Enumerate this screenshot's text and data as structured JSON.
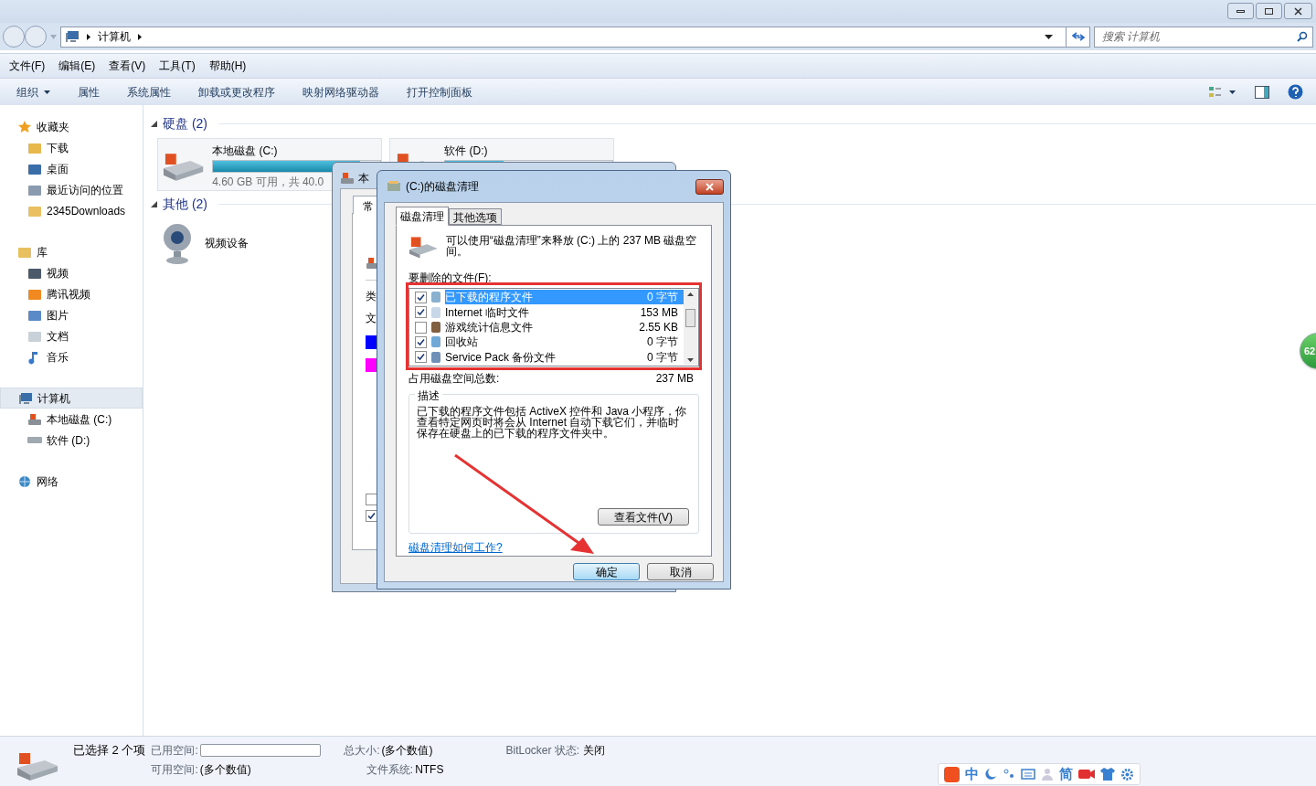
{
  "window": {
    "path": [
      "计算机"
    ],
    "search": {
      "placeholder": "搜索 计算机"
    }
  },
  "menu": [
    "文件(F)",
    "编辑(E)",
    "查看(V)",
    "工具(T)",
    "帮助(H)"
  ],
  "toolbar": [
    {
      "label": "组织",
      "dropdown": true
    },
    {
      "label": "属性",
      "dropdown": false
    },
    {
      "label": "系统属性",
      "dropdown": false
    },
    {
      "label": "卸载或更改程序",
      "dropdown": false
    },
    {
      "label": "映射网络驱动器",
      "dropdown": false
    },
    {
      "label": "打开控制面板",
      "dropdown": false
    }
  ],
  "sidebar": [
    {
      "label": "收藏夹",
      "kind": "star",
      "selected": false,
      "children": [
        {
          "label": "下载",
          "kind": "download",
          "selected": false
        },
        {
          "label": "桌面",
          "kind": "desktop",
          "selected": false
        },
        {
          "label": "最近访问的位置",
          "kind": "recent",
          "selected": false
        },
        {
          "label": "2345Downloads",
          "kind": "folder",
          "selected": false
        }
      ]
    },
    {
      "label": "库",
      "kind": "library",
      "selected": false,
      "children": [
        {
          "label": "视频",
          "kind": "video",
          "selected": false
        },
        {
          "label": "腾讯视频",
          "kind": "tencent",
          "selected": false
        },
        {
          "label": "图片",
          "kind": "picture",
          "selected": false
        },
        {
          "label": "文档",
          "kind": "document",
          "selected": false
        },
        {
          "label": "音乐",
          "kind": "music",
          "selected": false
        }
      ]
    },
    {
      "label": "计算机",
      "kind": "computer",
      "selected": true,
      "children": [
        {
          "label": "本地磁盘 (C:)",
          "kind": "systemdrive",
          "selected": false
        },
        {
          "label": "软件 (D:)",
          "kind": "drive",
          "selected": false
        }
      ]
    },
    {
      "label": "网络",
      "kind": "network",
      "selected": false
    }
  ],
  "sections": [
    {
      "title": "硬盘 (2)",
      "expanded": true,
      "items": [
        {
          "kind": "drive",
          "name": "本地磁盘 (C:)",
          "detail": "4.60 GB 可用，共 40.0",
          "level": 0.88
        },
        {
          "kind": "drive",
          "name": "软件 (D:)",
          "level": 0.35
        }
      ]
    },
    {
      "title": "其他 (2)",
      "expanded": true,
      "items": [
        {
          "kind": "camera",
          "name": "视频设备"
        }
      ]
    }
  ],
  "properties_window": {
    "title": "本",
    "tab": "常",
    "labels": [
      "类",
      "文"
    ],
    "swatches": [
      {
        "color": "#0000ff"
      },
      {
        "color": "#ff00ff"
      }
    ],
    "checkboxes": [
      {
        "checked": false
      },
      {
        "checked": true
      }
    ]
  },
  "cleanup_dialog": {
    "title": "(C:)的磁盘清理",
    "tabs": [
      {
        "label": "磁盘清理",
        "selected": true
      },
      {
        "label": "其他选项",
        "selected": false
      }
    ],
    "intro": "可以使用“磁盘清理”来释放 (C:) 上的 237 MB 磁盘空间。",
    "list_label": "要删除的文件(F):",
    "files": [
      {
        "name": "已下载的程序文件",
        "size": "0 字节",
        "checked": true,
        "selected": true
      },
      {
        "name": "Internet 临时文件",
        "size": "153 MB",
        "checked": true,
        "selected": false
      },
      {
        "name": "游戏统计信息文件",
        "size": "2.55 KB",
        "checked": false,
        "selected": false
      },
      {
        "name": "回收站",
        "size": "0 字节",
        "checked": true,
        "selected": false
      },
      {
        "name": "Service Pack 备份文件",
        "size": "0 字节",
        "checked": true,
        "selected": false
      }
    ],
    "total_label": "占用磁盘空间总数:",
    "total": "237 MB",
    "description_title": "描述",
    "description": "已下载的程序文件包括 ActiveX 控件和 Java 小程序，你查看特定网页时将会从 Internet 自动下载它们，并临时保存在硬盘上的已下载的程序文件夹中。",
    "view_button": "查看文件(V)",
    "help_link": "磁盘清理如何工作?",
    "buttons": [
      {
        "label": "确定",
        "default": true
      },
      {
        "label": "取消",
        "default": false
      }
    ]
  },
  "status_bar": {
    "selection": "已选择 2 个项",
    "used_label": "已用空间:",
    "free_label": "可用空间:",
    "free": "(多个数值)",
    "total_label": "总大小:",
    "total": "(多个数值)",
    "fs_label": "文件系统:",
    "fs": "NTFS",
    "bitlocker_label": "BitLocker 状态:",
    "bitlocker": "关闭"
  },
  "floating_ball": {
    "text": "62"
  },
  "ime_bar": [
    {
      "kind": "logo"
    },
    {
      "kind": "char",
      "text": "中"
    },
    {
      "kind": "moon"
    },
    {
      "kind": "punct"
    },
    {
      "kind": "keyboard"
    },
    {
      "kind": "user"
    },
    {
      "kind": "char",
      "text": "简"
    },
    {
      "kind": "video"
    },
    {
      "kind": "shirt"
    },
    {
      "kind": "gear"
    }
  ]
}
